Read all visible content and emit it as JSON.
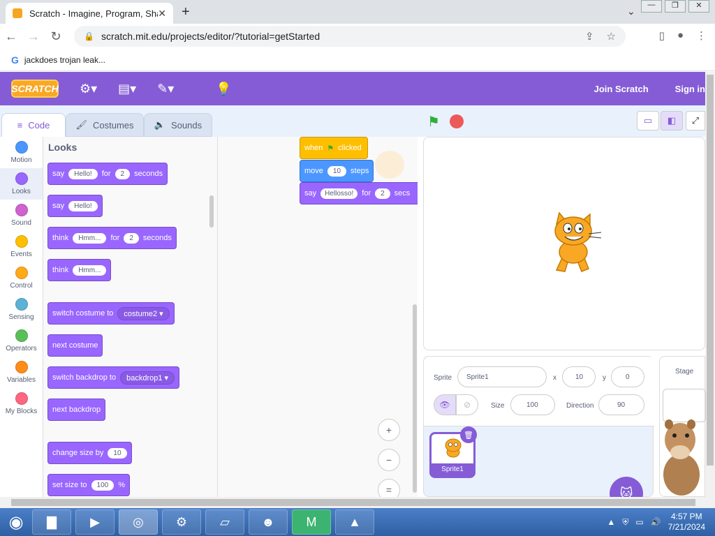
{
  "browser": {
    "tab_title": "Scratch - Imagine, Program, Shar",
    "tab_close": "✕",
    "new_tab": "+",
    "url": "scratch.mit.edu/projects/editor/?tutorial=getStarted",
    "bookmark": "jackdoes trojan leak..."
  },
  "menubar": {
    "logo": "SCRATCH",
    "join": "Join Scratch",
    "signin": "Sign in"
  },
  "tabs": {
    "code": "Code",
    "costumes": "Costumes",
    "sounds": "Sounds"
  },
  "categories": [
    {
      "label": "Motion",
      "color": "#4c97ff"
    },
    {
      "label": "Looks",
      "color": "#9966ff"
    },
    {
      "label": "Sound",
      "color": "#cf63cf"
    },
    {
      "label": "Events",
      "color": "#ffbf00"
    },
    {
      "label": "Control",
      "color": "#ffab19"
    },
    {
      "label": "Sensing",
      "color": "#5cb1d6"
    },
    {
      "label": "Operators",
      "color": "#59c059"
    },
    {
      "label": "Variables",
      "color": "#ff8c1a"
    },
    {
      "label": "My Blocks",
      "color": "#ff6680"
    }
  ],
  "palette": {
    "heading": "Looks",
    "b1": {
      "verb": "say",
      "text": "Hello!",
      "for": "for",
      "num": "2",
      "unit": "seconds"
    },
    "b2": {
      "verb": "say",
      "text": "Hello!"
    },
    "b3": {
      "verb": "think",
      "text": "Hmm...",
      "for": "for",
      "num": "2",
      "unit": "seconds"
    },
    "b4": {
      "verb": "think",
      "text": "Hmm..."
    },
    "b5": {
      "verb": "switch costume to",
      "value": "costume2"
    },
    "b6": {
      "verb": "next costume"
    },
    "b7": {
      "verb": "switch backdrop to",
      "value": "backdrop1"
    },
    "b8": {
      "verb": "next backdrop"
    },
    "b9": {
      "verb": "change size by",
      "num": "10"
    },
    "b10": {
      "verb": "set size to",
      "num": "100",
      "unit": "%"
    }
  },
  "script": {
    "when": "when",
    "clicked": "clicked",
    "move": "move",
    "steps_num": "10",
    "steps": "steps",
    "say": "say",
    "say_text": "Hellosso!",
    "for": "for",
    "secs_num": "2",
    "secs": "secs"
  },
  "zoom": {
    "in": "+",
    "out": "−",
    "reset": "="
  },
  "sprite": {
    "sprite_label": "Sprite",
    "name": "Sprite1",
    "x_label": "x",
    "x": "10",
    "y_label": "y",
    "y": "0",
    "size_label": "Size",
    "size": "100",
    "direction_label": "Direction",
    "direction": "90",
    "thumb_name": "Sprite1"
  },
  "stage_pane": {
    "label": "Stage"
  },
  "taskbar": {
    "time": "4:57 PM",
    "date": "7/21/2024"
  }
}
